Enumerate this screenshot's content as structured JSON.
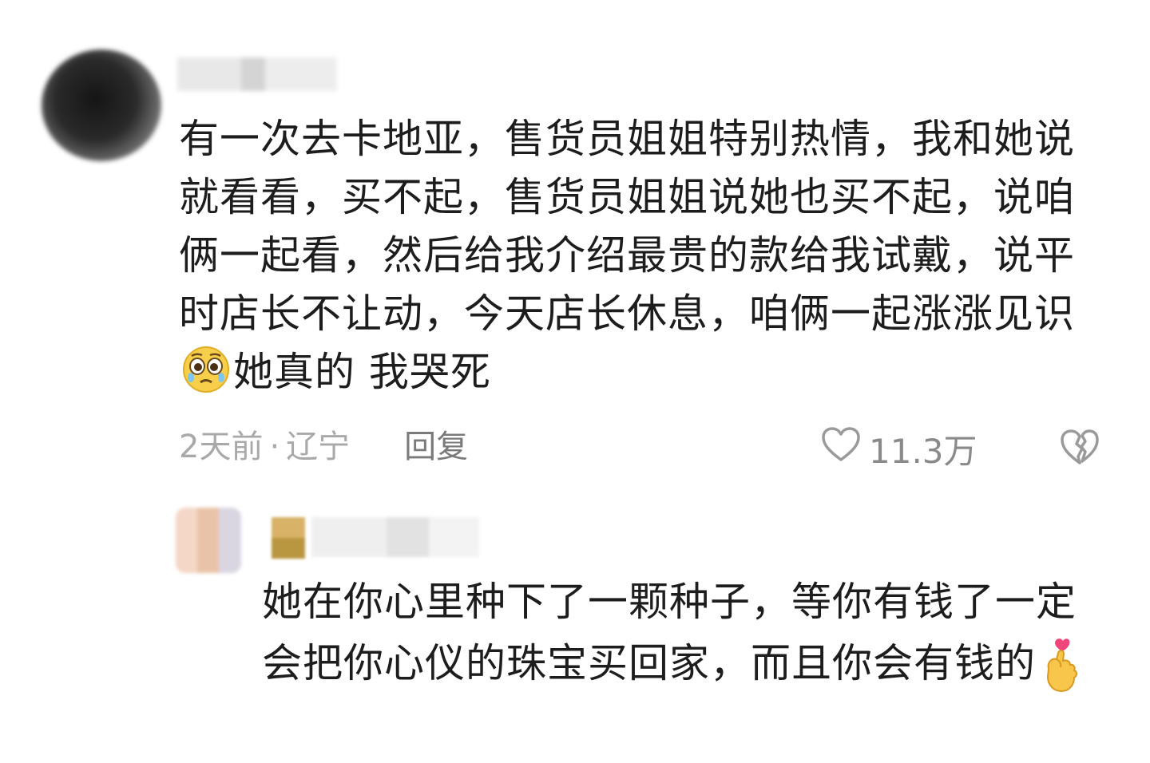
{
  "comment": {
    "text_part1": "有一次去卡地亚，售货员姐姐特别热情，我和她说就看看，买不起，售货员姐姐说她也买不起，说咱俩一起看，然后给我介绍最贵的款给我试戴，说平时店长不让动，今天店长休息，咱俩一起涨涨见识",
    "text_part2": "她真的 我哭死",
    "time": "2天前",
    "location": "辽宁",
    "separator": "·",
    "reply_label": "回复",
    "likes": "11.3万",
    "emoji": "pleading-face-icon"
  },
  "reply": {
    "text": "她在你心里种下了一颗种子，等你有钱了一定会把你心仪的珠宝买回家，而且你会有钱的",
    "emoji": "finger-heart-icon"
  },
  "colors": {
    "text": "#1d1d1d",
    "meta": "#a9a9a9",
    "reply_btn": "#7a7a7a",
    "like": "#8a8a8a"
  }
}
